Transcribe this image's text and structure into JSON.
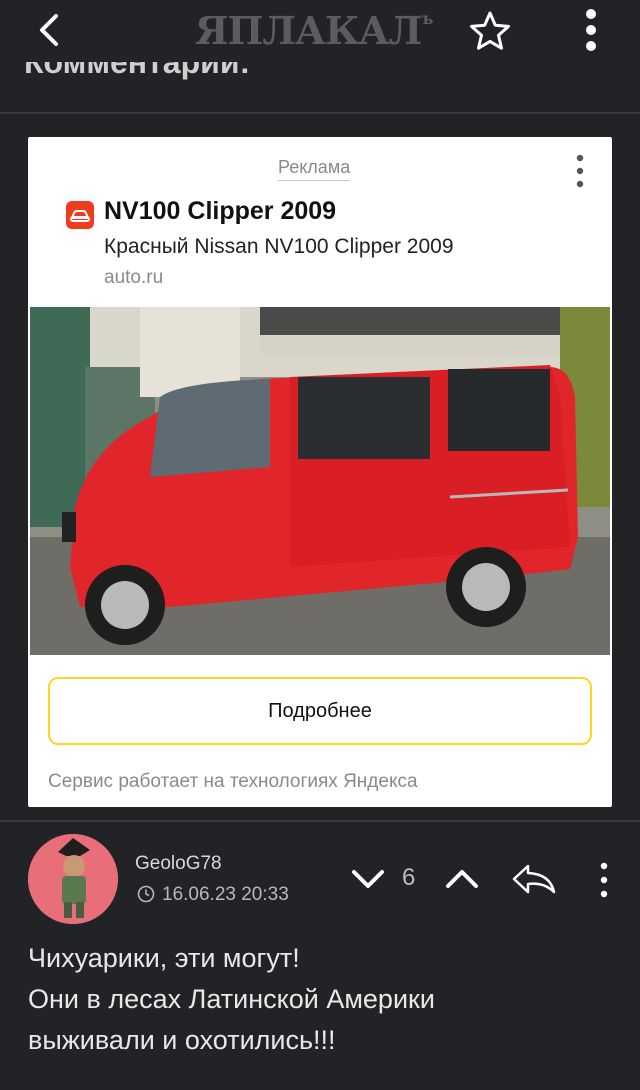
{
  "header": {
    "logo_text": "ЯПЛАКАЛ",
    "logo_suffix": "ъ",
    "back_icon": "chevron-left-icon",
    "favorite_icon": "star-outline-icon",
    "menu_icon": "kebab-menu-icon"
  },
  "section_heading": "Комментарии:",
  "ad": {
    "label": "Реклама",
    "title": "NV100 Clipper 2009",
    "subtitle": "Красный Nissan NV100 Clipper 2009",
    "domain": "auto.ru",
    "button_label": "Подробнее",
    "footer": "Сервис работает на технологиях Яндекса",
    "accent_color": "#ffd525",
    "icon_color": "#f03a1c"
  },
  "comment": {
    "username": "GeoloG78",
    "timestamp": "16.06.23 20:33",
    "rating": "6",
    "text_lines": [
      "Чихуарики, эти могут!",
      "Они в лесах Латинской Америки",
      "выживали и охотились!!!"
    ]
  },
  "colors": {
    "background": "#222326",
    "divider": "#3a3b3f"
  }
}
